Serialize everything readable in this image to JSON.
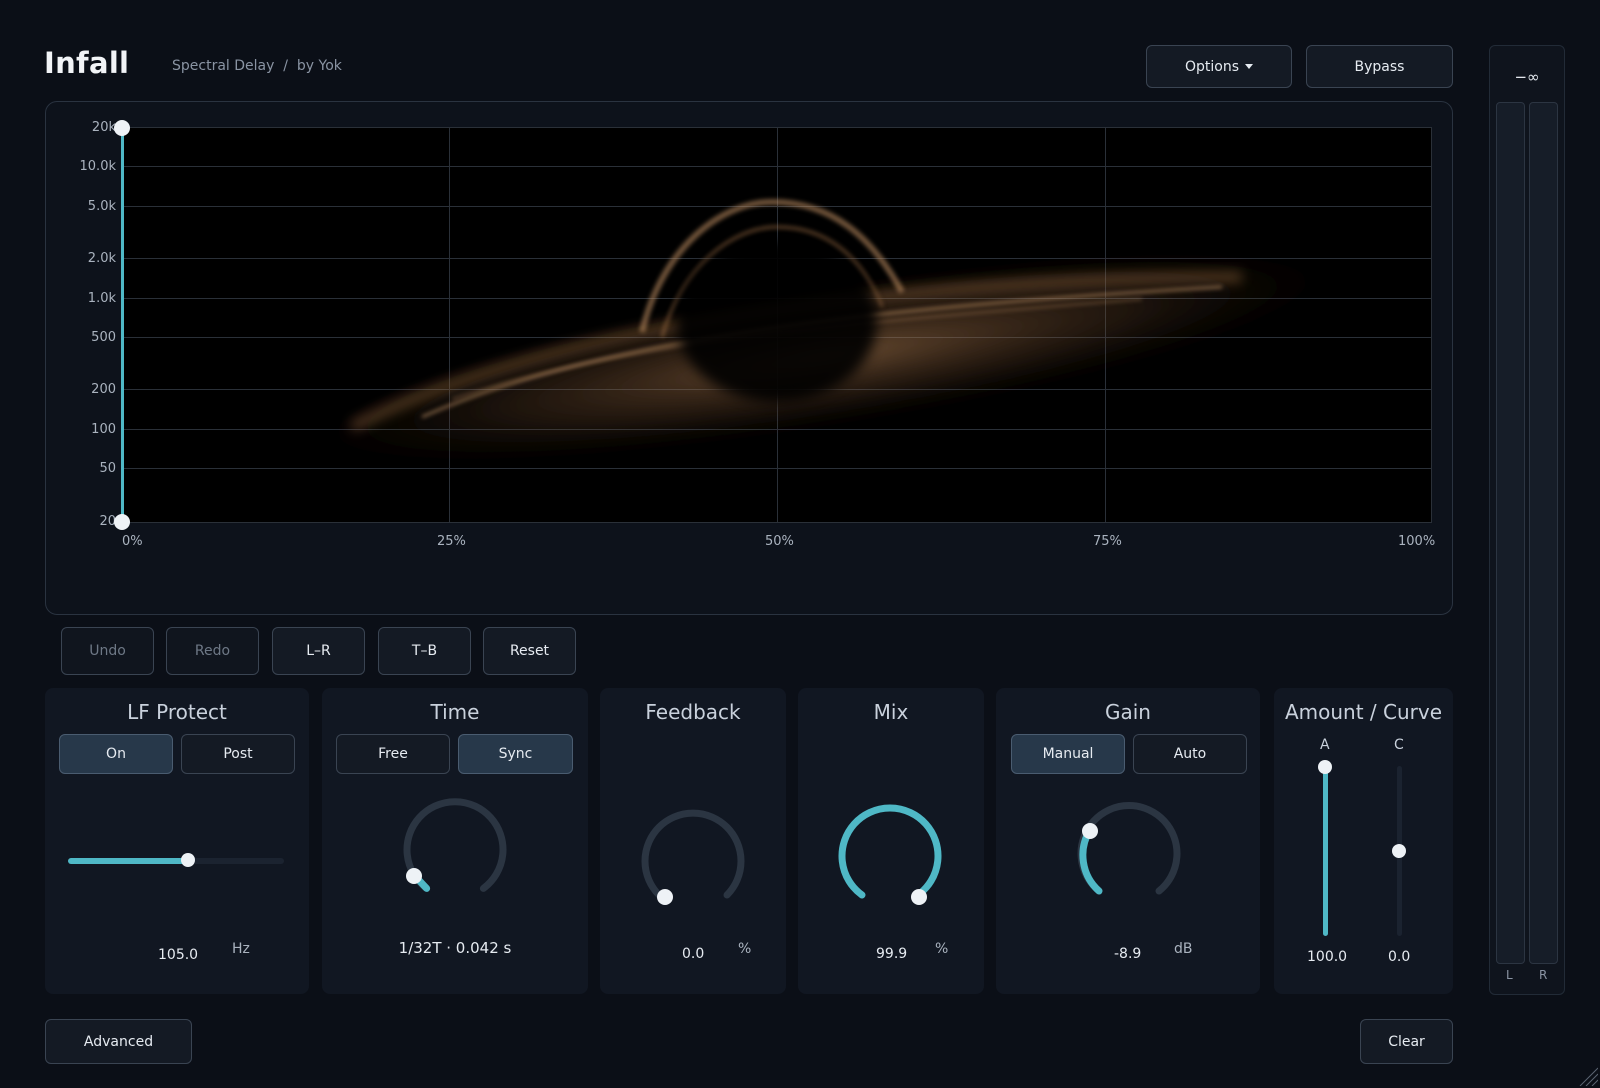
{
  "header": {
    "title": "Infall",
    "subtitle": "Spectral Delay  /  by Yok",
    "options_label": "Options",
    "bypass_label": "Bypass"
  },
  "graph": {
    "y_labels": [
      "20k",
      "10.0k",
      "5.0k",
      "2.0k",
      "1.0k",
      "500",
      "200",
      "100",
      "50",
      "20"
    ],
    "x_labels": [
      "0%",
      "25%",
      "50%",
      "75%",
      "100%"
    ]
  },
  "toolbar": {
    "undo_label": "Undo",
    "redo_label": "Redo",
    "lr_label": "L–R",
    "tb_label": "T–B",
    "reset_label": "Reset"
  },
  "lf_protect": {
    "title": "LF Protect",
    "on_label": "On",
    "post_label": "Post",
    "value": "105.0",
    "unit": "Hz",
    "slider_fraction": 0.55
  },
  "time": {
    "title": "Time",
    "free_label": "Free",
    "sync_label": "Sync",
    "value": "1/32T · 0.042 s"
  },
  "feedback": {
    "title": "Feedback",
    "value": "0.0",
    "unit": "%"
  },
  "mix": {
    "title": "Mix",
    "value": "99.9",
    "unit": "%"
  },
  "gain": {
    "title": "Gain",
    "manual_label": "Manual",
    "auto_label": "Auto",
    "value": "-8.9",
    "unit": "dB"
  },
  "amount_curve": {
    "title": "Amount / Curve",
    "a_label": "A",
    "c_label": "C",
    "a_value": "100.0",
    "c_value": "0.0"
  },
  "footer": {
    "advanced_label": "Advanced",
    "clear_label": "Clear"
  },
  "meter": {
    "readout": "−∞",
    "l_label": "L",
    "r_label": "R"
  },
  "colors": {
    "accent": "#4fb8c6",
    "background": "#0b0f17",
    "panel": "#111722"
  }
}
